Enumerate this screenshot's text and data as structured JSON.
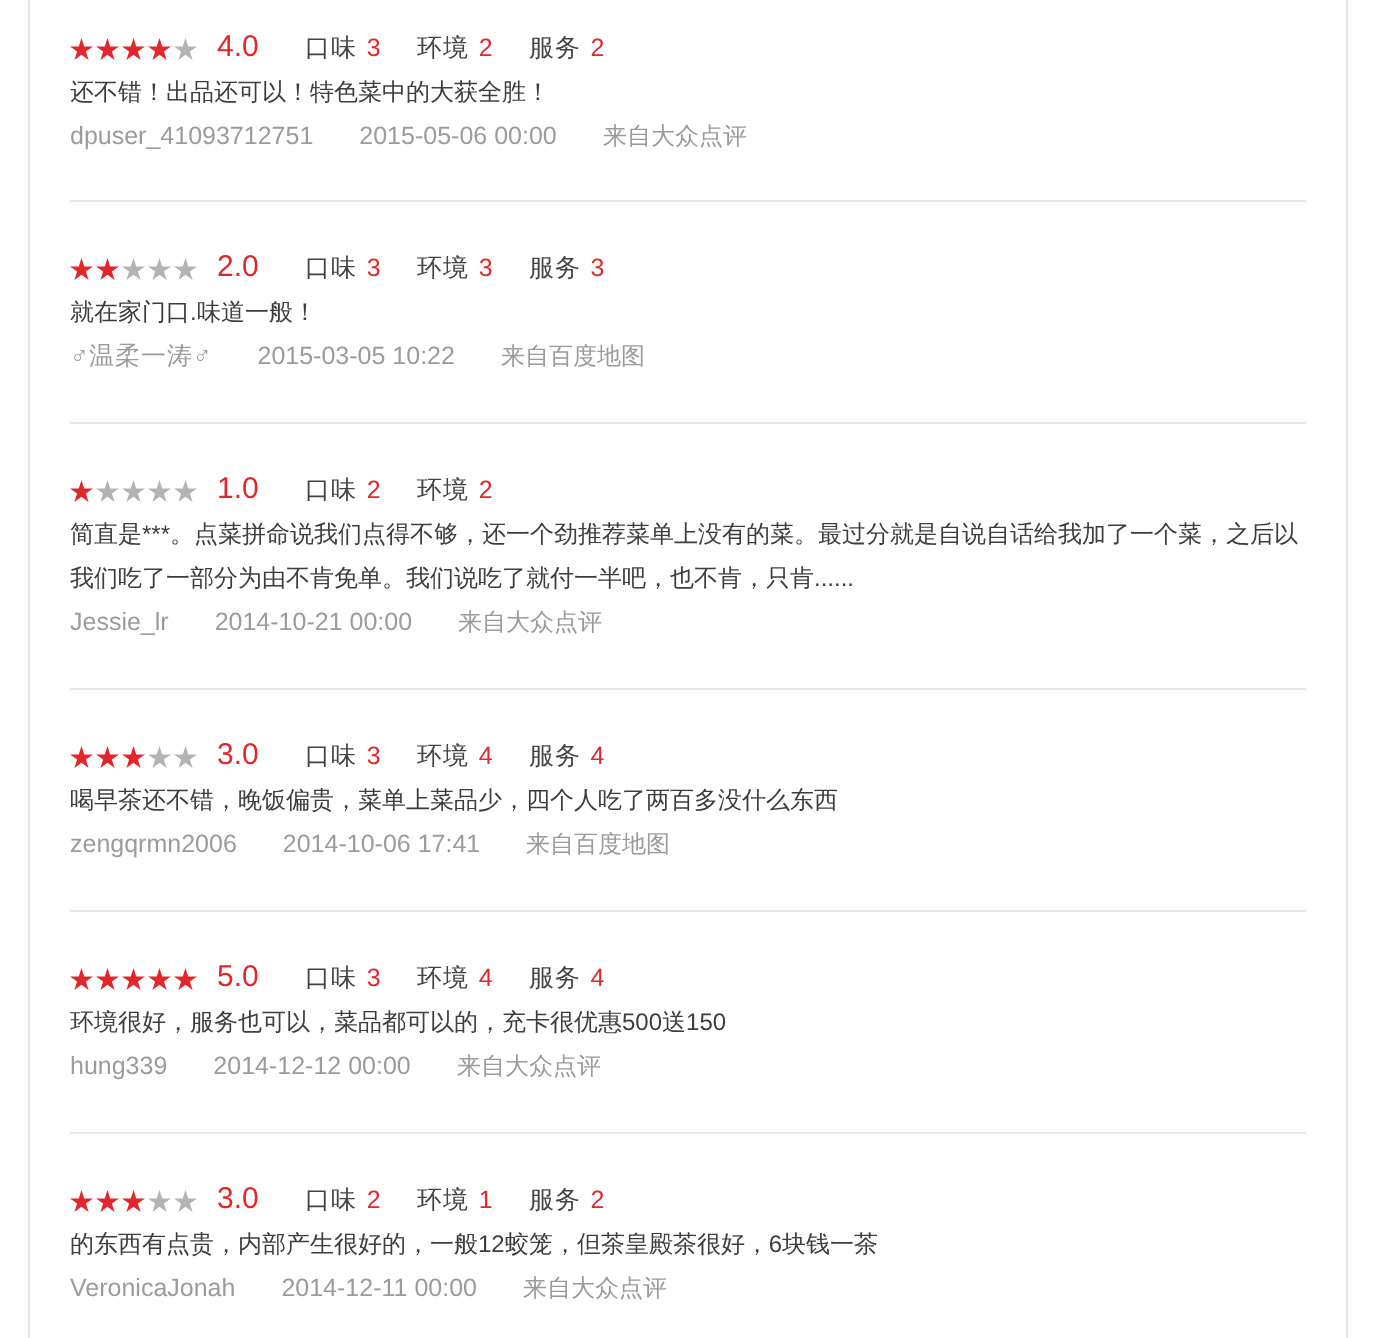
{
  "reviews": [
    {
      "stars": 4,
      "score": "4.0",
      "aspects": [
        {
          "label": "口味",
          "value": "3"
        },
        {
          "label": "环境",
          "value": "2"
        },
        {
          "label": "服务",
          "value": "2"
        }
      ],
      "comment": "还不错！出品还可以！特色菜中的大获全胜！",
      "user": "dpuser_41093712751",
      "time": "2015-05-06 00:00",
      "source": "来自大众点评"
    },
    {
      "stars": 2,
      "score": "2.0",
      "aspects": [
        {
          "label": "口味",
          "value": "3"
        },
        {
          "label": "环境",
          "value": "3"
        },
        {
          "label": "服务",
          "value": "3"
        }
      ],
      "comment": "就在家门口.味道一般！",
      "user": "♂温柔一涛♂",
      "time": "2015-03-05 10:22",
      "source": "来自百度地图"
    },
    {
      "stars": 1,
      "score": "1.0",
      "aspects": [
        {
          "label": "口味",
          "value": "2"
        },
        {
          "label": "环境",
          "value": "2"
        }
      ],
      "comment": "简直是***。点菜拼命说我们点得不够，还一个劲推荐菜单上没有的菜。最过分就是自说自话给我加了一个菜，之后以我们吃了一部分为由不肯免单。我们说吃了就付一半吧，也不肯，只肯......",
      "user": "Jessie_lr",
      "time": "2014-10-21 00:00",
      "source": "来自大众点评"
    },
    {
      "stars": 3,
      "score": "3.0",
      "aspects": [
        {
          "label": "口味",
          "value": "3"
        },
        {
          "label": "环境",
          "value": "4"
        },
        {
          "label": "服务",
          "value": "4"
        }
      ],
      "comment": "喝早茶还不错，晚饭偏贵，菜单上菜品少，四个人吃了两百多没什么东西",
      "user": "zengqrmn2006",
      "time": "2014-10-06 17:41",
      "source": "来自百度地图"
    },
    {
      "stars": 5,
      "score": "5.0",
      "aspects": [
        {
          "label": "口味",
          "value": "3"
        },
        {
          "label": "环境",
          "value": "4"
        },
        {
          "label": "服务",
          "value": "4"
        }
      ],
      "comment": "环境很好，服务也可以，菜品都可以的，充卡很优惠500送150",
      "user": "hung339",
      "time": "2014-12-12 00:00",
      "source": "来自大众点评"
    },
    {
      "stars": 3,
      "score": "3.0",
      "aspects": [
        {
          "label": "口味",
          "value": "2"
        },
        {
          "label": "环境",
          "value": "1"
        },
        {
          "label": "服务",
          "value": "2"
        }
      ],
      "comment": "的东西有点贵，内部产生很好的，一般12蛟笼，但茶皇殿茶很好，6块钱一茶",
      "user": "VeronicaJonah",
      "time": "2014-12-11 00:00",
      "source": "来自大众点评"
    }
  ]
}
